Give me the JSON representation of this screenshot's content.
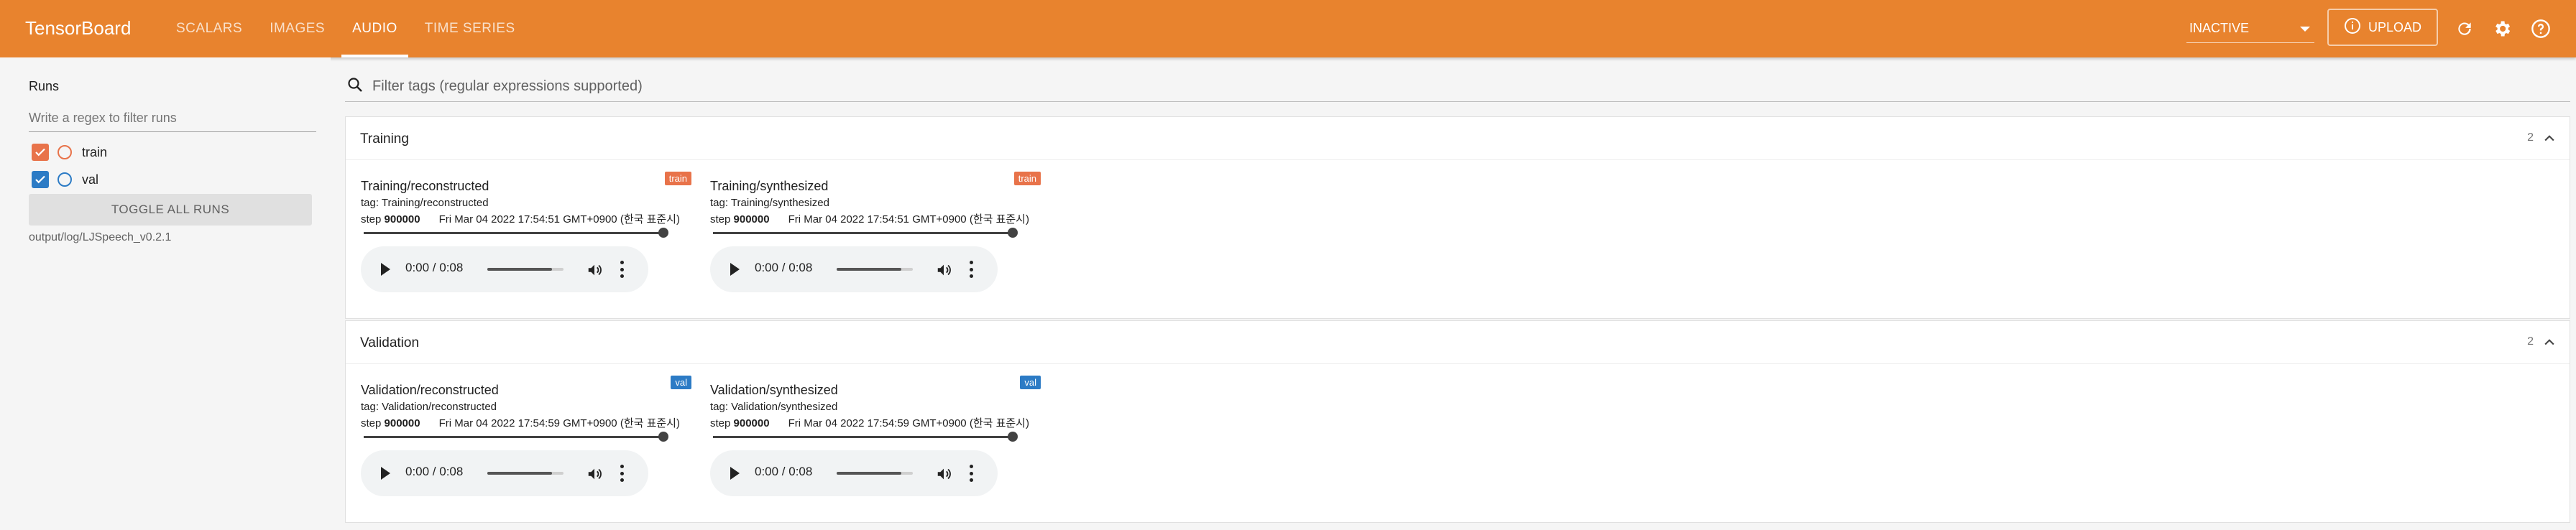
{
  "header": {
    "brand": "TensorBoard",
    "tabs": [
      {
        "label": "SCALARS",
        "active": false
      },
      {
        "label": "IMAGES",
        "active": false
      },
      {
        "label": "AUDIO",
        "active": true
      },
      {
        "label": "TIME SERIES",
        "active": false
      }
    ],
    "status_value": "INACTIVE",
    "upload_label": "UPLOAD",
    "icons": [
      "info-icon",
      "refresh-icon",
      "settings-icon",
      "help-icon"
    ],
    "accent_color": "#e8832e"
  },
  "sidebar": {
    "title": "Runs",
    "filter_placeholder": "Write a regex to filter runs",
    "runs": [
      {
        "label": "train",
        "checked": true,
        "color": "#e8734a"
      },
      {
        "label": "val",
        "checked": true,
        "color": "#2c7bc5"
      }
    ],
    "toggle_label": "TOGGLE ALL RUNS",
    "logdir": "output/log/LJSpeech_v0.2.1"
  },
  "main": {
    "search_placeholder": "Filter tags (regular expressions supported)",
    "groups": [
      {
        "title": "Training",
        "count": "2",
        "cards": [
          {
            "title": "Training/reconstructed",
            "tag": "tag: Training/reconstructed",
            "step_label": "step",
            "step": "900000",
            "timestamp": "Fri Mar 04 2022 17:54:51 GMT+0900 (한국 표준시)",
            "badge": "train",
            "time": "0:00 / 0:08",
            "volume": 0.85
          },
          {
            "title": "Training/synthesized",
            "tag": "tag: Training/synthesized",
            "step_label": "step",
            "step": "900000",
            "timestamp": "Fri Mar 04 2022 17:54:51 GMT+0900 (한국 표준시)",
            "badge": "train",
            "time": "0:00 / 0:08",
            "volume": 0.85
          }
        ]
      },
      {
        "title": "Validation",
        "count": "2",
        "cards": [
          {
            "title": "Validation/reconstructed",
            "tag": "tag: Validation/reconstructed",
            "step_label": "step",
            "step": "900000",
            "timestamp": "Fri Mar 04 2022 17:54:59 GMT+0900 (한국 표준시)",
            "badge": "val",
            "time": "0:00 / 0:08",
            "volume": 0.85
          },
          {
            "title": "Validation/synthesized",
            "tag": "tag: Validation/synthesized",
            "step_label": "step",
            "step": "900000",
            "timestamp": "Fri Mar 04 2022 17:54:59 GMT+0900 (한국 표준시)",
            "badge": "val",
            "time": "0:00 / 0:08",
            "volume": 0.85
          }
        ]
      }
    ]
  }
}
